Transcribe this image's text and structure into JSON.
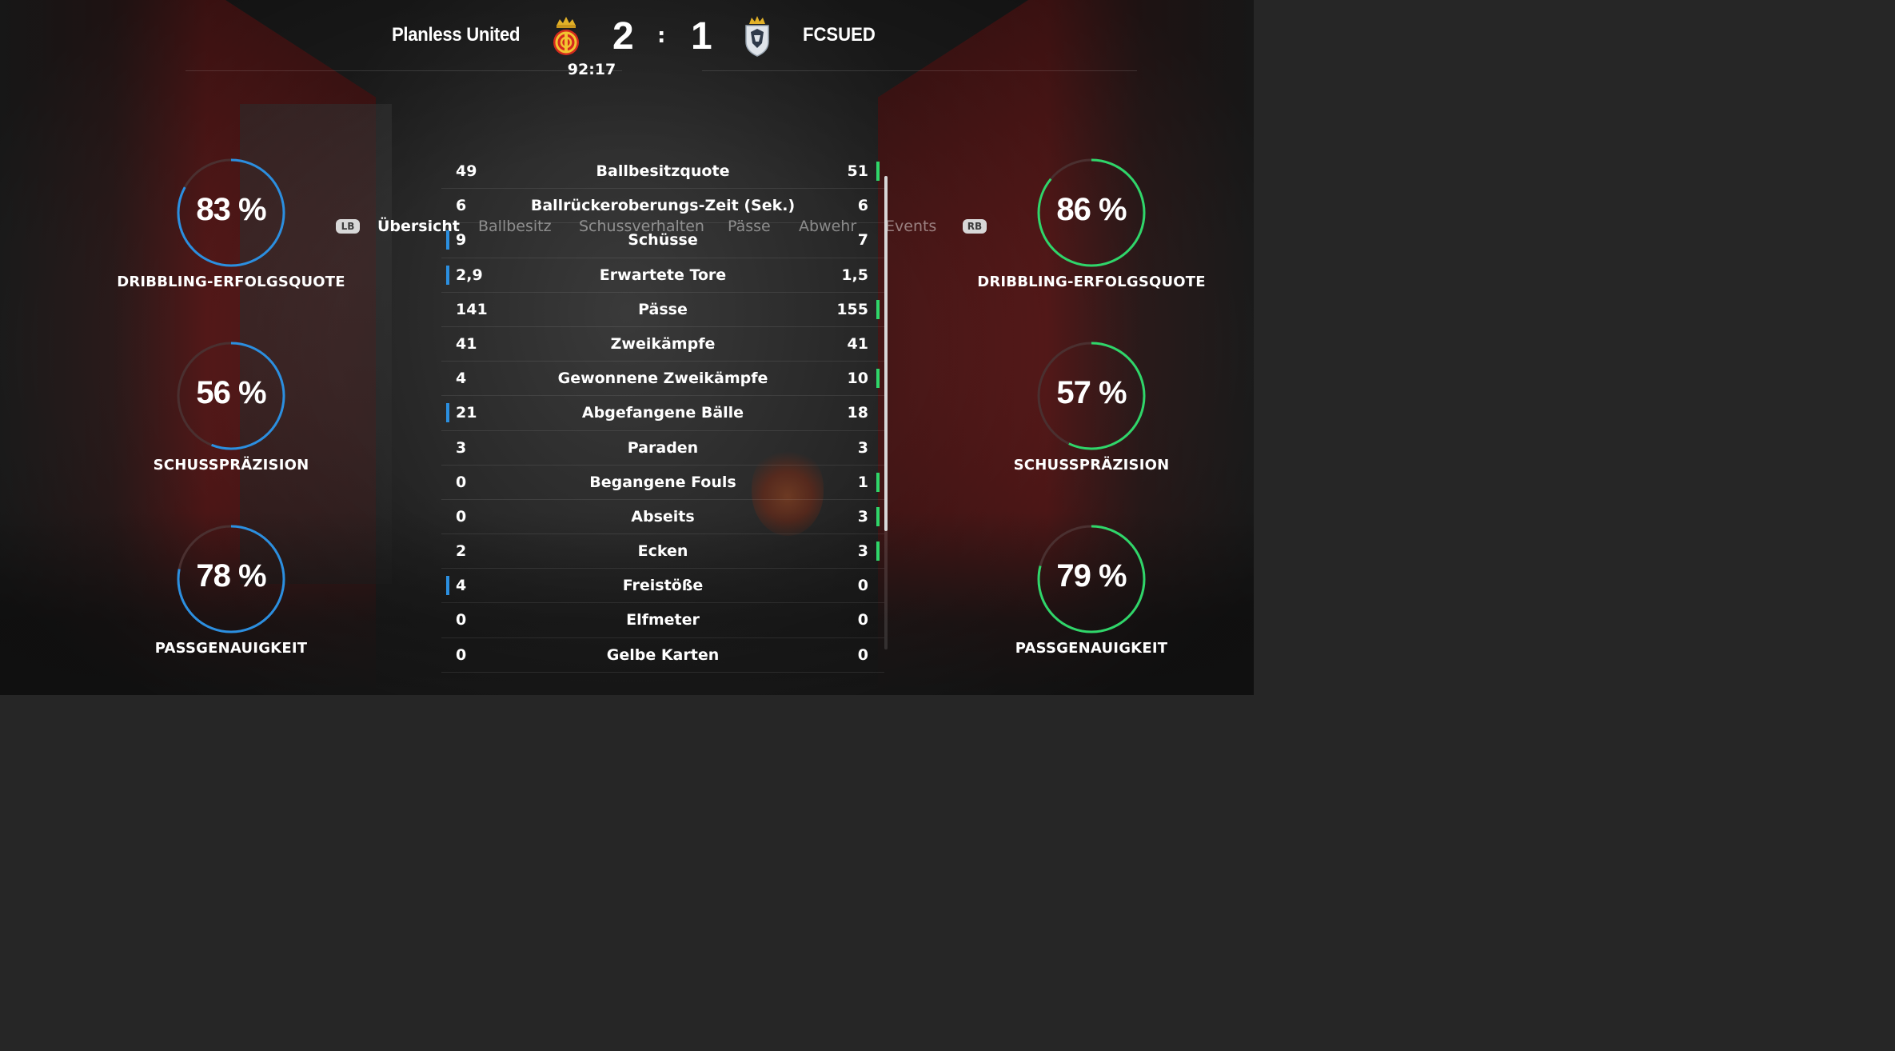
{
  "match": {
    "home_team": "Planless United",
    "away_team": "FCSUED",
    "home_score": "2",
    "separator": ":",
    "away_score": "1",
    "clock": "92:17"
  },
  "tabs": {
    "lb": "LB",
    "rb": "RB",
    "items": [
      "Übersicht",
      "Ballbesitz",
      "Schussverhalten",
      "Pässe",
      "Abwehr",
      "Events"
    ],
    "active": "Übersicht"
  },
  "home_gauges": [
    {
      "value": "83 %",
      "percent": 83,
      "label": "DRIBBLING-ERFOLGSQUOTE"
    },
    {
      "value": "56 %",
      "percent": 56,
      "label": "SCHUSSPRÄZISION"
    },
    {
      "value": "78 %",
      "percent": 78,
      "label": "PASSGENAUIGKEIT"
    }
  ],
  "away_gauges": [
    {
      "value": "86 %",
      "percent": 86,
      "label": "DRIBBLING-ERFOLGSQUOTE"
    },
    {
      "value": "57 %",
      "percent": 57,
      "label": "SCHUSSPRÄZISION"
    },
    {
      "value": "79 %",
      "percent": 79,
      "label": "PASSGENAUIGKEIT"
    }
  ],
  "stats": [
    {
      "home": "49",
      "name": "Ballbesitzquote",
      "away": "51",
      "leader": "away"
    },
    {
      "home": "6",
      "name": "Ballrückeroberungs-Zeit (Sek.)",
      "away": "6",
      "leader": "none"
    },
    {
      "home": "9",
      "name": "Schüsse",
      "away": "7",
      "leader": "home"
    },
    {
      "home": "2,9",
      "name": "Erwartete Tore",
      "away": "1,5",
      "leader": "home"
    },
    {
      "home": "141",
      "name": "Pässe",
      "away": "155",
      "leader": "away"
    },
    {
      "home": "41",
      "name": "Zweikämpfe",
      "away": "41",
      "leader": "none"
    },
    {
      "home": "4",
      "name": "Gewonnene Zweikämpfe",
      "away": "10",
      "leader": "away"
    },
    {
      "home": "21",
      "name": "Abgefangene Bälle",
      "away": "18",
      "leader": "home"
    },
    {
      "home": "3",
      "name": "Paraden",
      "away": "3",
      "leader": "none"
    },
    {
      "home": "0",
      "name": "Begangene Fouls",
      "away": "1",
      "leader": "away"
    },
    {
      "home": "0",
      "name": "Abseits",
      "away": "3",
      "leader": "away"
    },
    {
      "home": "2",
      "name": "Ecken",
      "away": "3",
      "leader": "away"
    },
    {
      "home": "4",
      "name": "Freistöße",
      "away": "0",
      "leader": "home"
    },
    {
      "home": "0",
      "name": "Elfmeter",
      "away": "0",
      "leader": "none"
    },
    {
      "home": "0",
      "name": "Gelbe Karten",
      "away": "0",
      "leader": "none"
    }
  ],
  "colors": {
    "home_accent": "#2b8fe0",
    "away_accent": "#2fd66a",
    "ring_track": "#4a3030"
  },
  "icons": {
    "home_crest": "mallorca-crest-icon",
    "away_crest": "shield-crest-icon"
  }
}
